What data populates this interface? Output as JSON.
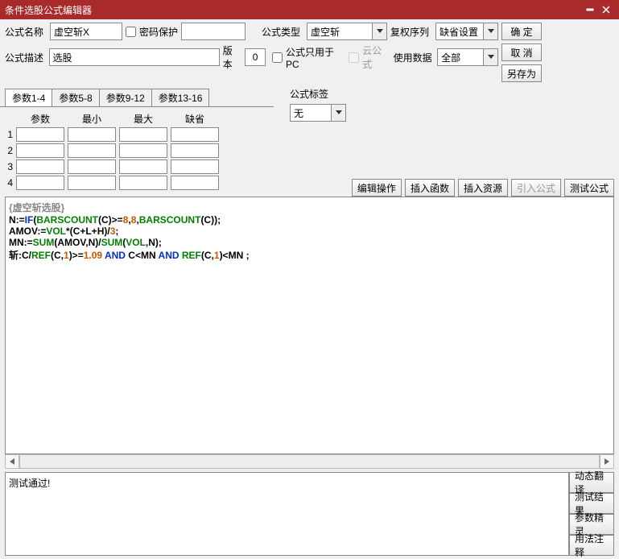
{
  "title": "条件选股公式编辑器",
  "labels": {
    "name": "公式名称",
    "desc": "公式描述",
    "pwd": "密码保护",
    "ver": "版本",
    "type": "公式类型",
    "dup": "复权序列",
    "pc": "公式只用于PC",
    "cloud": "云公式",
    "use": "使用数据",
    "tag": "公式标签"
  },
  "values": {
    "name": "虚空斩X",
    "desc": "选股",
    "ver": "0",
    "type": "虚空斩",
    "dup": "缺省设置",
    "use": "全部",
    "tag": "无"
  },
  "buttons": {
    "ok": "确 定",
    "cancel": "取 消",
    "saveas": "另存为",
    "editop": "编辑操作",
    "insfn": "插入函数",
    "insres": "插入资源",
    "import": "引入公式",
    "test": "测试公式",
    "dyntrans": "动态翻译",
    "testres": "测试结果",
    "paramwiz": "参数精灵",
    "usage": "用法注释"
  },
  "tabs": [
    "参数1-4",
    "参数5-8",
    "参数9-12",
    "参数13-16"
  ],
  "paramheads": [
    "参数",
    "最小",
    "最大",
    "缺省"
  ],
  "codetitle": "{虚空斩选股}",
  "status": "测试通过!",
  "code": {
    "l1a": "N:=",
    "l1b": "IF",
    "l1c": "(",
    "l1d": "BARSCOUNT",
    "l1e": "(C)>=",
    "l1f": "8",
    "l1g": ",",
    "l1h": "8",
    "l1i": ",",
    "l1j": "BARSCOUNT",
    "l1k": "(C));",
    "l2a": "AMOV:=",
    "l2b": "VOL",
    "l2c": "*(C+L+H)/",
    "l2d": "3",
    "l2e": ";",
    "l3a": "MN:=",
    "l3b": "SUM",
    "l3c": "(AMOV,N)/",
    "l3d": "SUM",
    "l3e": "(",
    "l3f": "VOL",
    "l3g": ",N);",
    "l4a": "斩:C/",
    "l4b": "REF",
    "l4c": "(C,",
    "l4d": "1",
    "l4e": ")>=",
    "l4f": "1.09",
    "l4g": " AND ",
    "l4h": "C<MN",
    "l4i": " AND ",
    "l4j": "REF",
    "l4k": "(C,",
    "l4l": "1",
    "l4m": ")<MN ;"
  }
}
